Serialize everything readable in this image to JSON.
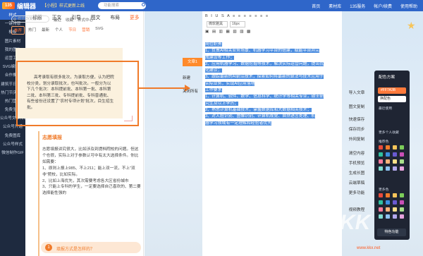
{
  "topbar": {
    "logo_badge": "135",
    "logo_text": "编辑器",
    "promo": "【小程】样式更新上线",
    "search_placeholder": "功能搜索",
    "nav": [
      "首页",
      "素材库",
      "135服务",
      "帐户/续费",
      "使用帮助"
    ]
  },
  "sidebar": {
    "items": [
      "样式",
      "一键排版",
      "模板",
      "图片素材",
      "我的图片",
      "运营工具",
      "SVG编辑器",
      "合作推广",
      "建筑节日专题",
      "热门节庆素材",
      "热门营销",
      "免费生成",
      "公众号文章排版",
      "公众号开通",
      "免费图库",
      "公众号样式",
      "微信制作GIF"
    ]
  },
  "panel": {
    "tabs": [
      "标题",
      "正文",
      "引导",
      "图文",
      "布局",
      "更多"
    ],
    "search_placeholder": "样式ID/关键词",
    "filters": [
      "最近",
      "收藏",
      "样式中心"
    ],
    "subtabs": [
      "推荐",
      "热门",
      "最新",
      "个人",
      "节日",
      "营销",
      "SVG"
    ],
    "paper_text": "高考录取有很多批次，为录取方便，认为把院校分类，划分录取批次，也叫批次。一般分为以下几个批次：本科提前批、本科第一批、本科第二批、本科第三批、专科提前批、专科普通批、有些省份还设置了“农村专项计划”批次，目生招生批。",
    "tips_title": "志愿填报",
    "tips": [
      "志愿填报讲究很大，比如涉及到提档院校的问题。但这个也很，实际上对于参数认可中有太大选择条件。你比如需要：",
      "1、原则上报上985、不上211；能上双一流，不上“双非”院校，比如实际。",
      "2、比如上海优先，其次需要考虑各大区省份城市",
      "3、只能上专科的学生，一定要选择自己喜欢的、第二要选择能性强的"
    ],
    "pill_num": "1",
    "pill_text": "填报方式是怎样的？"
  },
  "side_buttons": {
    "orange": "文章1",
    "new": "新建",
    "clear": "关闭所有"
  },
  "editor": {
    "toolbar_row1": "B I U S A ≡ ≡ ≡ ≡ ≡ ≡ ≡",
    "font_family": "微软雅黑",
    "font_size": "16px",
    "toolbar_row3": "▣ ▤ ▥ ▦ ▧ ▨ ▩",
    "selected_lines": [
      "岗位职责",
      "1、负责AI相关业务场景、机器学习平台的搭建，赋能平台并完",
      "成建设等工作；",
      "2、应用机器学习、数据挖掘等技术，解决实际运营问题，提出优",
      "化建议；",
      "3、跟踪最新的AI前沿技术，探索如何将最新的算法与技术应用于",
      "实际业务，实现AI应用落地",
      "工作要求",
      "1、计算机、软件、数学、信息科学、统计学等相关专业，硕士研",
      "究生及以上学历；",
      "2、熟悉计算机基础技术，掌握数据库和大数据相关技术；",
      "3、对人脸识别、图像识别、计算机视觉、自然语言处理、机",
      "器学习领域有一定理解和经验者优先"
    ]
  },
  "tools": {
    "items": [
      "导入文章",
      "图文复制",
      "快速保存",
      "保存同步",
      "外网复制",
      "清空内容",
      "手机预览",
      "生成长图",
      "云端草稿",
      "更多功能",
      "视频教程"
    ]
  },
  "palette": {
    "title": "配色方案",
    "color_value": "#FF7A3B",
    "select_value": "换配色",
    "label_recent": "最近使用",
    "label_more": "更多个人收藏",
    "label_recommend": "推荐色",
    "label_custom": "更多色",
    "bottom_btn": "特色功能",
    "swatches": [
      "#e84b3c",
      "#f07b2a",
      "#f6c55a",
      "#7ccd5a",
      "#2fbfa0",
      "#3b8ee0",
      "#6a5ad1",
      "#c94fb6",
      "#ff7a9c",
      "#ffb37a",
      "#ffe08a",
      "#a8e08a",
      "#7fdcd0",
      "#8ec2f2",
      "#b3a8ec",
      "#e6a3dd"
    ]
  },
  "watermark": {
    "text": "KK",
    "url": "www.kkx.net"
  }
}
